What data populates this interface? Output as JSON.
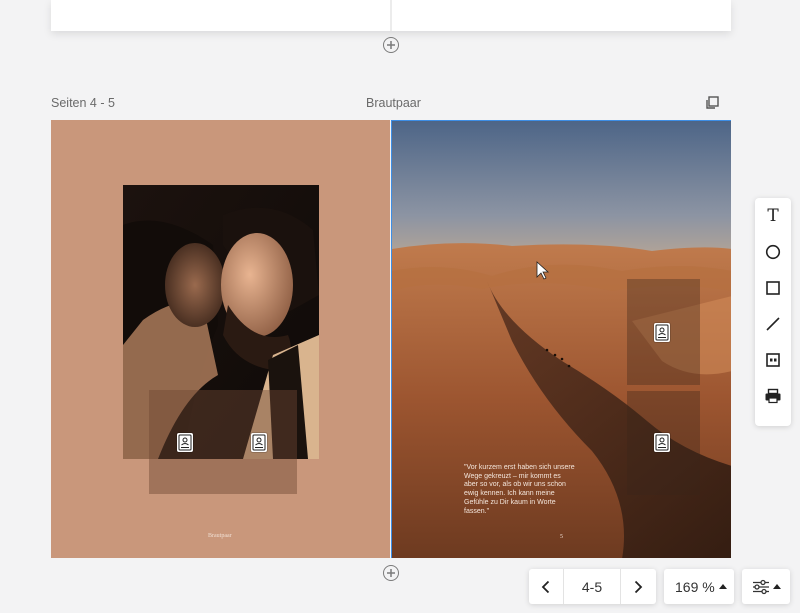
{
  "spread": {
    "pages_label": "Seiten 4 - 5",
    "title": "Brautpaar"
  },
  "left_page": {
    "footer_text": "Brautpaar"
  },
  "right_page": {
    "quote": "\"Vor kurzem erst haben sich unsere Wege gekreuzt – mir kommt es aber so vor, als ob wir uns schon ewig kennen. Ich kann meine Gefühle zu Dir kaum in Worte fassen.\"",
    "page_number": "5"
  },
  "toolbar": {
    "tools": [
      "text-tool",
      "ellipse-tool",
      "rectangle-tool",
      "line-tool",
      "placeholder-tool",
      "print-tool"
    ],
    "text_tool_glyph": "T"
  },
  "navigation": {
    "page_range": "4-5",
    "zoom": "169 %"
  },
  "colors": {
    "left_page_bg": "#c9977b",
    "selection": "#3d8ee6",
    "background": "#f3f3f4"
  }
}
